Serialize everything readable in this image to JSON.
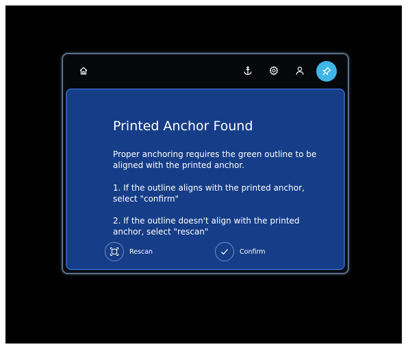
{
  "dialog": {
    "title": "Printed Anchor Found",
    "intro": "Proper anchoring requires the green outline to be aligned with the printed anchor.",
    "step1": "1. If the outline aligns with the printed anchor, select \"confirm\"",
    "step2": "2. If the outline doesn't align with the printed anchor, select \"rescan\"",
    "rescan_label": "Rescan",
    "confirm_label": "Confirm"
  },
  "toolbar": {
    "icons": [
      "home-icon",
      "anchor-icon",
      "gear-icon",
      "user-icon",
      "pin-icon"
    ]
  },
  "colors": {
    "content_bg": "#163d87",
    "accent": "#3fb6e8",
    "panel_bg": "#05070b"
  }
}
